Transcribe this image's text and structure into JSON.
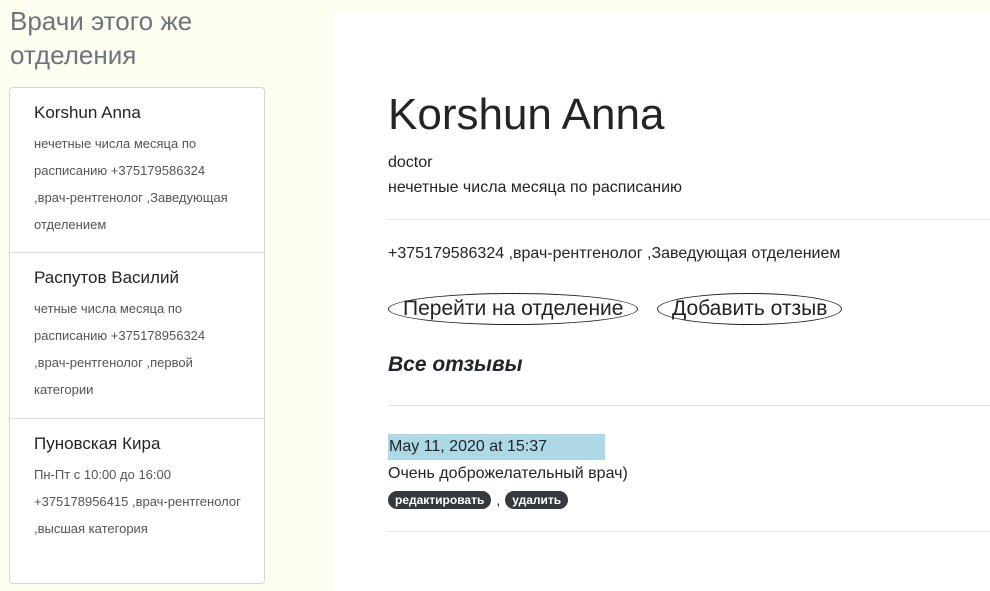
{
  "sidebar": {
    "title": "Врачи этого же отделения",
    "doctors": [
      {
        "name": "Korshun Anna",
        "description": "нечетные числа месяца по расписанию +375179586324 ,врач-рентгенолог ,Заведующая отделением"
      },
      {
        "name": "Распутов Василий",
        "description": "четные числа месяца по расписанию +375178956324 ,врач-рентгенолог ,первой категории"
      },
      {
        "name": "Пуновская Кира",
        "description": "Пн-Пт с 10:00 до 16:00 +375178956415 ,врач-рентгенолог ,высшая категория"
      }
    ]
  },
  "doctor": {
    "name": "Korshun Anna",
    "role": "doctor",
    "schedule": "нечетные числа месяца по расписанию",
    "contact": "+375179586324 ,врач-рентгенолог ,Заведующая отделением"
  },
  "buttons": {
    "go_to_department": "Перейти на отделение",
    "add_review": "Добавить отзыв"
  },
  "reviews": {
    "title": "Все отзывы",
    "items": [
      {
        "date": "May 11, 2020 at 15:37",
        "text": "Очень доброжелательный врач)",
        "edit_label": "редактировать",
        "separator": ",",
        "delete_label": "удалить"
      }
    ]
  },
  "colors": {
    "page_background": "#fdfdf0",
    "date_highlight": "#add8e6",
    "badge": "#343a40"
  }
}
